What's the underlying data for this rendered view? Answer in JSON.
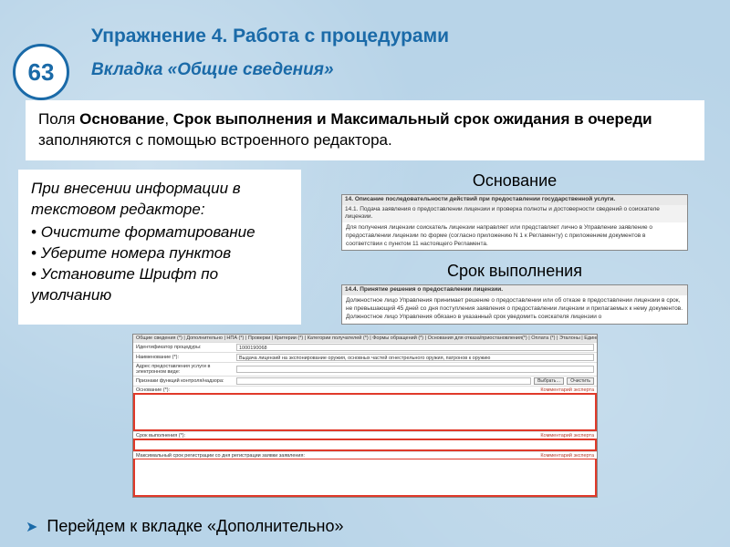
{
  "slide_number": "63",
  "title": "Упражнение 4. Работа с процедурами",
  "subtitle": "Вкладка «Общие сведения»",
  "intro": {
    "pre": "Поля ",
    "b1": "Основание",
    "mid1": ", ",
    "b2": "Срок выполнения и Максимальный срок ожидания в очереди",
    "post": " заполняются с помощью встроенного редактора."
  },
  "tips": {
    "heading": "При внесении информации в текстовом редакторе:",
    "items": [
      "Очистите форматирование",
      "Уберите номера пунктов",
      "Установите Шрифт по умолчанию"
    ]
  },
  "shots": {
    "label1": "Основание",
    "s1_bar": "14. Описание последовательности действий при предоставлении государственной услуги.",
    "s1_bar2": "14.1. Подача заявления о предоставлении лицензии и проверка полноты и достоверности сведений о соискателе лицензии.",
    "s1_body": "Для получения лицензии соискатель лицензии направляет или представляет лично в Управление заявление о предоставлении лицензии по форме (согласно приложению N 1 к Регламенту) с приложением документов в соответствии с пунктом 11 настоящего Регламента.",
    "label2": "Срок выполнения",
    "s2_bar": "14.4. Принятие решения о предоставлении лицензии.",
    "s2_body1": "Должностное лицо Управления принимает решение о предоставлении или об отказе в предоставлении лицензии в срок, не превышающий 45 дней со дня поступления заявления о предоставлении лицензии и прилагаемых к нему документов.",
    "s2_body2": "Должностное лицо Управления обязано в указанный срок уведомить соискателя лицензии о"
  },
  "form": {
    "tabs": "Общие сведения (*) | Дополнительно | НПА (*) | Проверки | Критерии (*) | Категории получателей (*) | Формы обращений (*) | Основания для отказа/приостановления(*) | Оплата (*) | Эталоны | Единый классификатор |",
    "rows": [
      {
        "label": "Идентификатор процедуры:",
        "value": "1000190068"
      },
      {
        "label": "Наименование (*):",
        "value": "Выдача лицензий на экспонирование оружия, основных частей огнестрельного оружия, патронов к оружию"
      },
      {
        "label": "Адрес предоставления услуги в электронном виде:",
        "value": ""
      }
    ],
    "ctrl_label": "Признаки функций контроля/надзора:",
    "btn_select": "Выбрать…",
    "btn_clear": "Очистить",
    "edit1_left": "Основание (*):",
    "edit_right": "Комментарий эксперта",
    "edit2_left": "Срок выполнения (*):",
    "edit3_left": "Максимальный срок регистрации со дня регистрации заявки заявления:"
  },
  "footer": "Перейдем к вкладке «Дополнительно»"
}
